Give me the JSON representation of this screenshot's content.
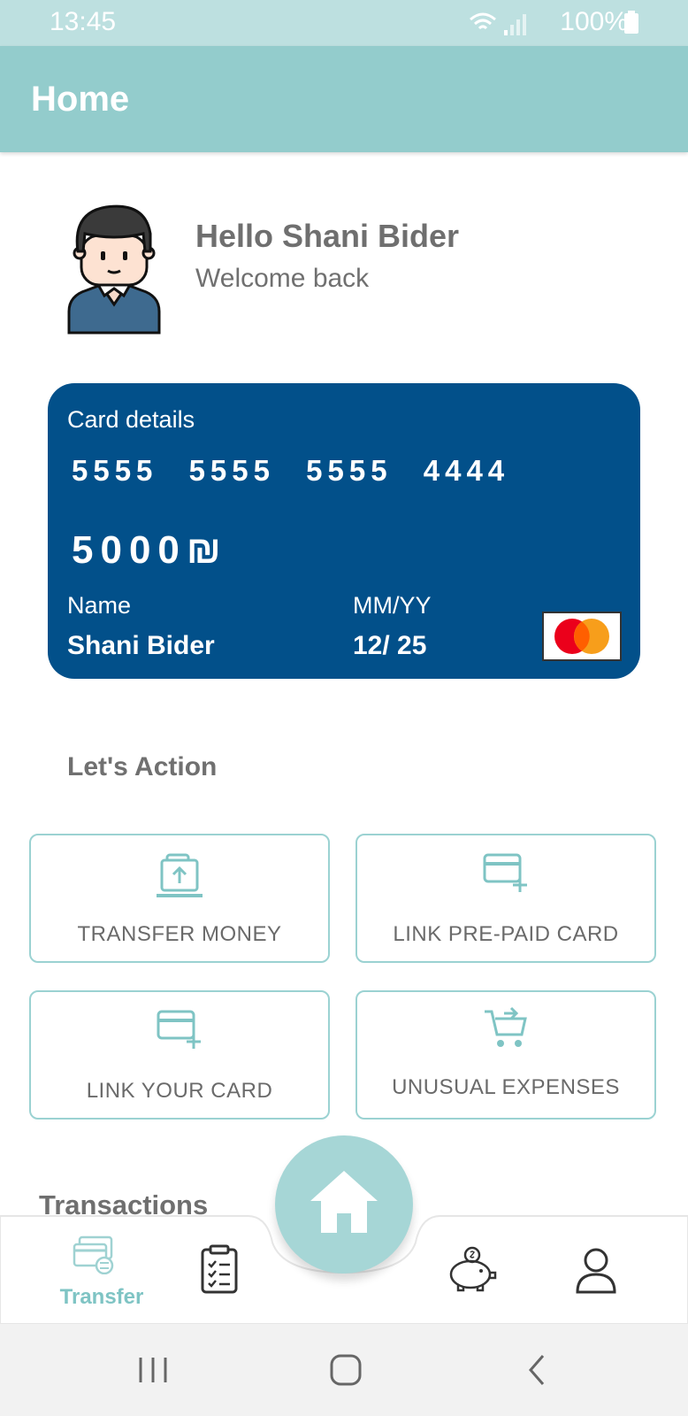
{
  "status_bar": {
    "time": "13:45",
    "battery": "100%"
  },
  "app_bar": {
    "title": "Home"
  },
  "greeting": {
    "title": "Hello Shani Bider",
    "subtitle": "Welcome back"
  },
  "card": {
    "label": "Card details",
    "number": "5555 5555 5555 4444",
    "balance": "5000",
    "currency_symbol": "₪",
    "name_label": "Name",
    "name_value": "Shani Bider",
    "expiry_label": "MM/YY",
    "expiry_value": "12/ 25",
    "color": "#02508a"
  },
  "actions": {
    "title": "Let's Action",
    "items": [
      {
        "label": "TRANSFER MONEY",
        "icon": "transfer-money-icon"
      },
      {
        "label": "LINK PRE-PAID CARD",
        "icon": "add-card-icon"
      },
      {
        "label": "LINK YOUR CARD",
        "icon": "add-card-icon"
      },
      {
        "label": "UNUSUAL EXPENSES",
        "icon": "cart-icon"
      }
    ]
  },
  "transactions": {
    "title": "Transactions"
  },
  "bottom_nav": {
    "items": [
      {
        "label": "Transfer",
        "icon": "card-transfer-icon",
        "active": true
      },
      {
        "icon": "clipboard-icon"
      },
      {
        "icon": "home-icon"
      },
      {
        "icon": "piggy-bank-icon"
      },
      {
        "icon": "user-icon"
      }
    ]
  },
  "colors": {
    "accent": "#93cccc",
    "status_bar": "#bde0e0",
    "card": "#02508a",
    "text_gray": "#707070"
  }
}
